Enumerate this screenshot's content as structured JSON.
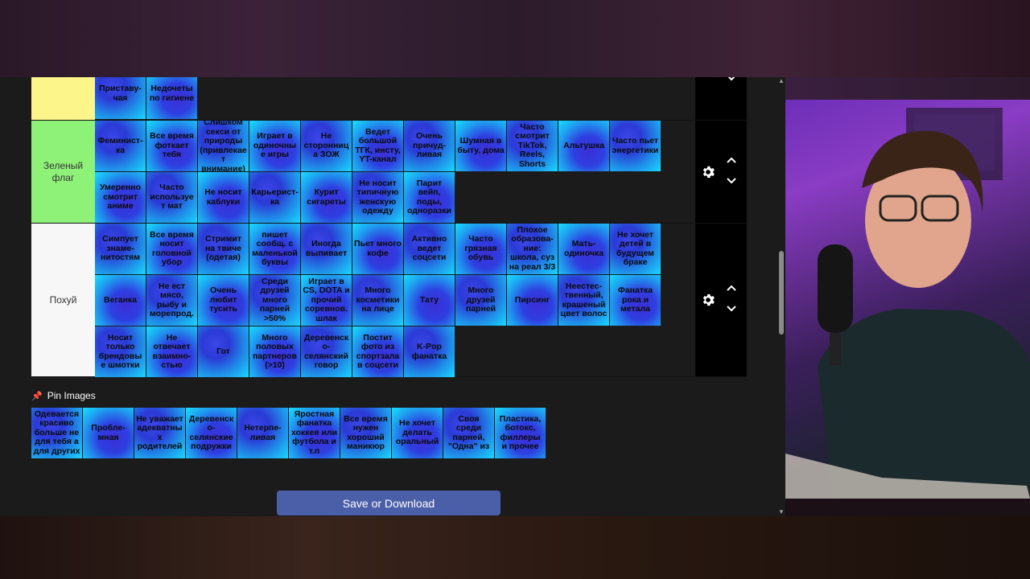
{
  "colors": {
    "tier_yellow": "#fbf58a",
    "tier_green": "#8ef278",
    "tier_white": "#f7f7f7",
    "save_button": "#4a5fa8"
  },
  "tiers": [
    {
      "label": "",
      "color": "#fbf58a",
      "items": [
        "Приставу-чая",
        "Недочеты по гигиене"
      ]
    },
    {
      "label": "Зеленый флаг",
      "color": "#8ef278",
      "items": [
        "Феминист-ка",
        "Все время фоткает тебя",
        "Слишком секси от природы (привлекает внимание)",
        "Играет в одиночные игры",
        "Не сторонница ЗОЖ",
        "Ведет большой ТГК, инсту, YT-канал",
        "Очень причуд-ливая",
        "Шумная в быту, дома",
        "Часто смотрит TikTok, Reels, Shorts",
        "Альтушка",
        "Часто пьет энергетики",
        "Умеренно смотрит аниме",
        "Часто использует мат",
        "Не носит каблуки",
        "Карьерист-ка",
        "Курит сигареты",
        "Не носит типичную женскую одежду",
        "Парит вейп, поды, одноразки"
      ]
    },
    {
      "label": "Похуй",
      "color": "#f7f7f7",
      "items": [
        "Симпует знаме-нитостям",
        "Все время носит головной убор",
        "Стримит на твиче (одетая)",
        "пишет сообщ. с маленькой буквы",
        "Иногда выпивает",
        "Пьет много кофе",
        "Активно ведет соцсети",
        "Часто грязная обувь",
        "Плохое образова-ние: школа, суз на реал 3/3",
        "Мать-одиночка",
        "Не хочет детей в будущем браке",
        "Веганка",
        "Не ест мясо, рыбу и морепрод.",
        "Очень любит тусить",
        "Среди друзей много парней >50%",
        "Играет в CS, DOTA и прочий соревнов. шлак",
        "Много косметики на лице",
        "Тату",
        "Много друзей парней",
        "Пирсинг",
        "Неестес-твенный, крашеный цвет волос",
        "Фанатка рока и метала",
        "Носит только брендовые шмотки",
        "Не отвечает взаимно-стью",
        "Гот",
        "Много половых партнеров (>10)",
        "Деревенско-селянский говор",
        "Постит фото из спортзала в соцсети",
        "K-Pop фанатка"
      ]
    }
  ],
  "pin": {
    "title": "Pin Images",
    "items": [
      "Одевается красиво больше не для тебя а для других",
      "Пробле-мная",
      "Не уважает адекватных родителей",
      "Деревенско-селянские подружки",
      "Нетерпе-ливая",
      "Яростная фанатка хоккея или футбола и т.п",
      "Все время нужен хороший маникюр",
      "Не хочет делать оральный",
      "Своя среди парней, \"Одна\" из",
      "Пластика, ботокс, филлеры и прочее"
    ]
  },
  "save_label": "Save or Download"
}
